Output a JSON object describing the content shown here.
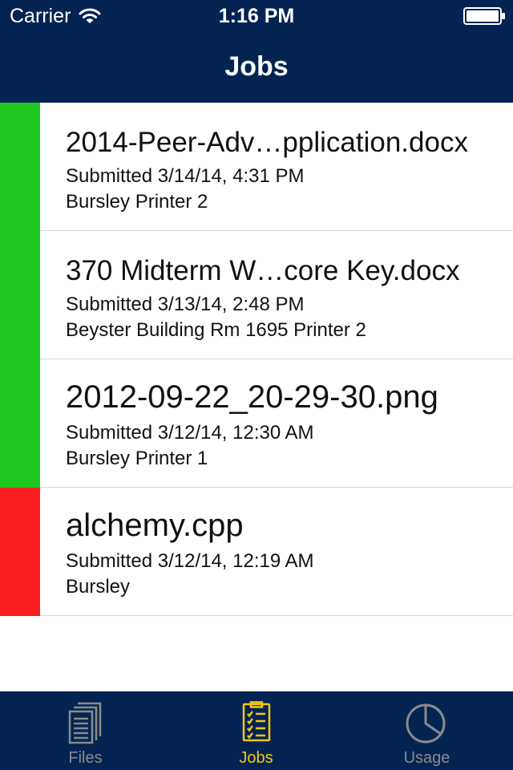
{
  "status_bar": {
    "carrier": "Carrier",
    "time": "1:16 PM",
    "wifi_icon": "wifi-icon",
    "battery_icon": "battery-icon"
  },
  "nav": {
    "title": "Jobs",
    "background_color": "#032452"
  },
  "jobs": [
    {
      "name": "2014-Peer-Adv…pplication.docx",
      "submitted": "Submitted 3/14/14, 4:31 PM",
      "printer": "Bursley Printer 2",
      "status_color": "#1ec81e"
    },
    {
      "name": "370 Midterm W…core Key.docx",
      "submitted": "Submitted 3/13/14, 2:48 PM",
      "printer": "Beyster Building Rm 1695 Printer 2",
      "status_color": "#1ec81e"
    },
    {
      "name": "2012-09-22_20-29-30.png",
      "submitted": "Submitted 3/12/14, 12:30 AM",
      "printer": "Bursley Printer 1",
      "status_color": "#1ec81e"
    },
    {
      "name": "alchemy.cpp",
      "submitted": "Submitted 3/12/14, 12:19 AM",
      "printer": "Bursley",
      "status_color": "#fa1e1e"
    }
  ],
  "tab_bar": {
    "tabs": [
      {
        "label": "Files",
        "icon": "files-icon",
        "selected": false
      },
      {
        "label": "Jobs",
        "icon": "jobs-icon",
        "selected": true
      },
      {
        "label": "Usage",
        "icon": "usage-icon",
        "selected": false
      }
    ],
    "selected_color": "#f5c518",
    "unselected_color": "#8a8a8a"
  }
}
